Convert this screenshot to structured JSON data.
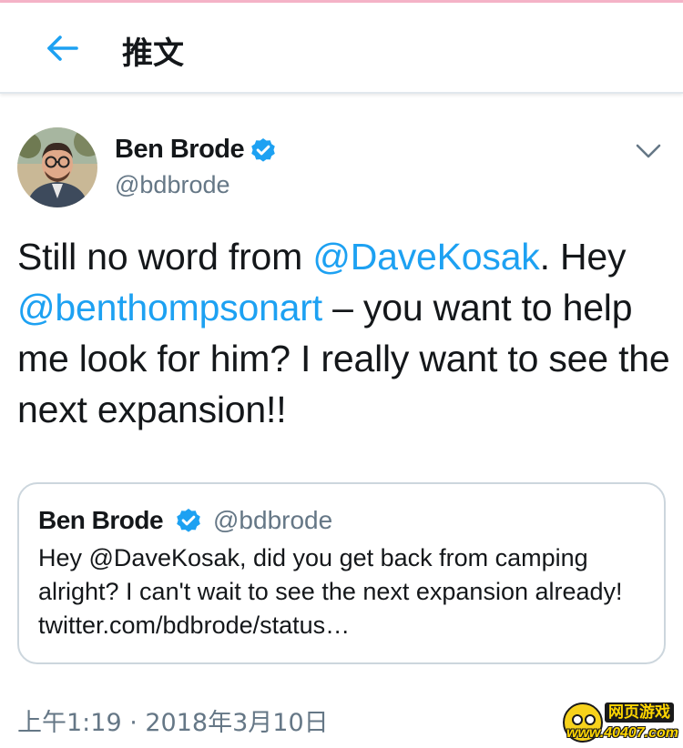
{
  "header": {
    "title": "推文",
    "back_icon": "arrow-left-icon"
  },
  "tweet": {
    "author": {
      "name": "Ben Brode",
      "handle": "@bdbrode",
      "verified_icon": "verified-badge-icon"
    },
    "body": {
      "seg1": "Still no word from ",
      "mention1": "@DaveKosak",
      "seg2": ". Hey ",
      "mention2": "@benthompsonart",
      "seg3": " – you want to help me look for him? I really want to see the next expansion!!"
    },
    "timestamp": "上午1:19 · 2018年3月10日"
  },
  "quote": {
    "name": "Ben Brode",
    "handle": "@bdbrode",
    "text": "Hey @DaveKosak, did you get back from camping alright? I can't wait to see the next expansion already! twitter.com/bdbrode/status…"
  },
  "watermark": {
    "top_text": "网页游戏",
    "bottom_text": "www.40407.com"
  },
  "colors": {
    "accent": "#1da1f2",
    "text": "#14171a",
    "secondary": "#657786",
    "border": "#ccd6dd"
  }
}
